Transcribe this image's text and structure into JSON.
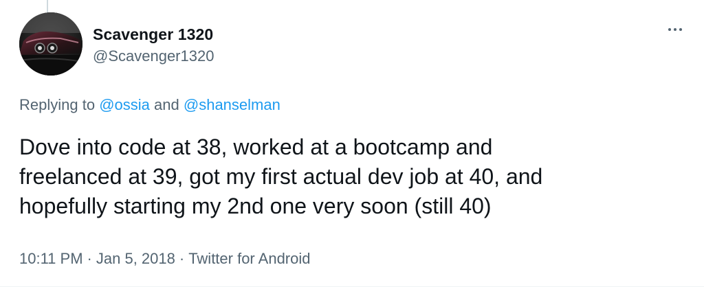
{
  "user": {
    "display_name": "Scavenger 1320",
    "handle": "@Scavenger1320"
  },
  "more_icon": "more-horizontal-icon",
  "reply": {
    "prefix": "Replying to",
    "mention_1": "@ossia",
    "joiner": "and",
    "mention_2": "@shanselman"
  },
  "tweet": {
    "lines": [
      "Dove into code at 38, worked at a bootcamp and",
      "freelanced at 39, got my first actual dev job at 40, and",
      "hopefully starting my 2nd one very soon (still 40)"
    ]
  },
  "meta": {
    "time": "10:11 PM",
    "date": "Jan 5, 2018",
    "separator": "·",
    "source": "Twitter for Android"
  },
  "colors": {
    "text_primary": "#0f1419",
    "text_secondary": "#536471",
    "link": "#1d9bf0"
  }
}
